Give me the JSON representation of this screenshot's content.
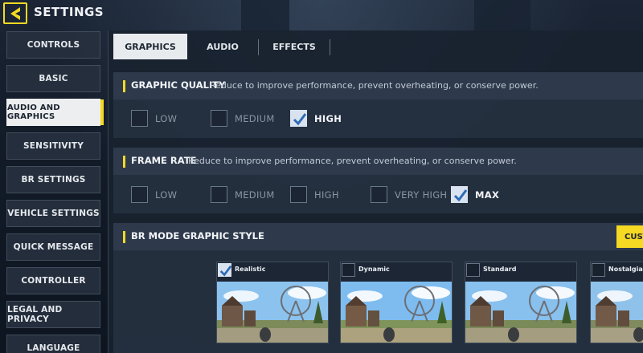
{
  "header": {
    "title": "SETTINGS",
    "back_icon": "chevron-left-icon",
    "accent": "#f5d922"
  },
  "sidebar": {
    "items": [
      {
        "label": "CONTROLS",
        "active": false
      },
      {
        "label": "BASIC",
        "active": false
      },
      {
        "label": "AUDIO AND GRAPHICS",
        "active": true
      },
      {
        "label": "SENSITIVITY",
        "active": false
      },
      {
        "label": "BR SETTINGS",
        "active": false
      },
      {
        "label": "VEHICLE SETTINGS",
        "active": false
      },
      {
        "label": "QUICK MESSAGE",
        "active": false
      },
      {
        "label": "CONTROLLER",
        "active": false
      },
      {
        "label": "LEGAL AND PRIVACY",
        "active": false
      },
      {
        "label": "LANGUAGE",
        "active": false
      }
    ]
  },
  "tabs": [
    {
      "label": "GRAPHICS",
      "active": true
    },
    {
      "label": "AUDIO",
      "active": false
    },
    {
      "label": "EFFECTS",
      "active": false
    }
  ],
  "graphic_quality": {
    "title": "GRAPHIC QUALITY",
    "description": "Reduce to improve performance, prevent overheating, or conserve power.",
    "options": [
      {
        "label": "LOW",
        "checked": false
      },
      {
        "label": "MEDIUM",
        "checked": false
      },
      {
        "label": "HIGH",
        "checked": true
      }
    ]
  },
  "frame_rate": {
    "title": "FRAME RATE",
    "description": "Reduce to improve performance, prevent overheating, or conserve power.",
    "options": [
      {
        "label": "LOW",
        "checked": false
      },
      {
        "label": "MEDIUM",
        "checked": false
      },
      {
        "label": "HIGH",
        "checked": false
      },
      {
        "label": "VERY HIGH",
        "checked": false
      },
      {
        "label": "MAX",
        "checked": true
      }
    ]
  },
  "br_mode_style": {
    "title": "BR MODE GRAPHIC STYLE",
    "custom_label": "CUSTOM",
    "styles": [
      {
        "label": "Realistic",
        "checked": true
      },
      {
        "label": "Dynamic",
        "checked": false
      },
      {
        "label": "Standard",
        "checked": false
      },
      {
        "label": "Nostalgia",
        "checked": false
      }
    ]
  }
}
